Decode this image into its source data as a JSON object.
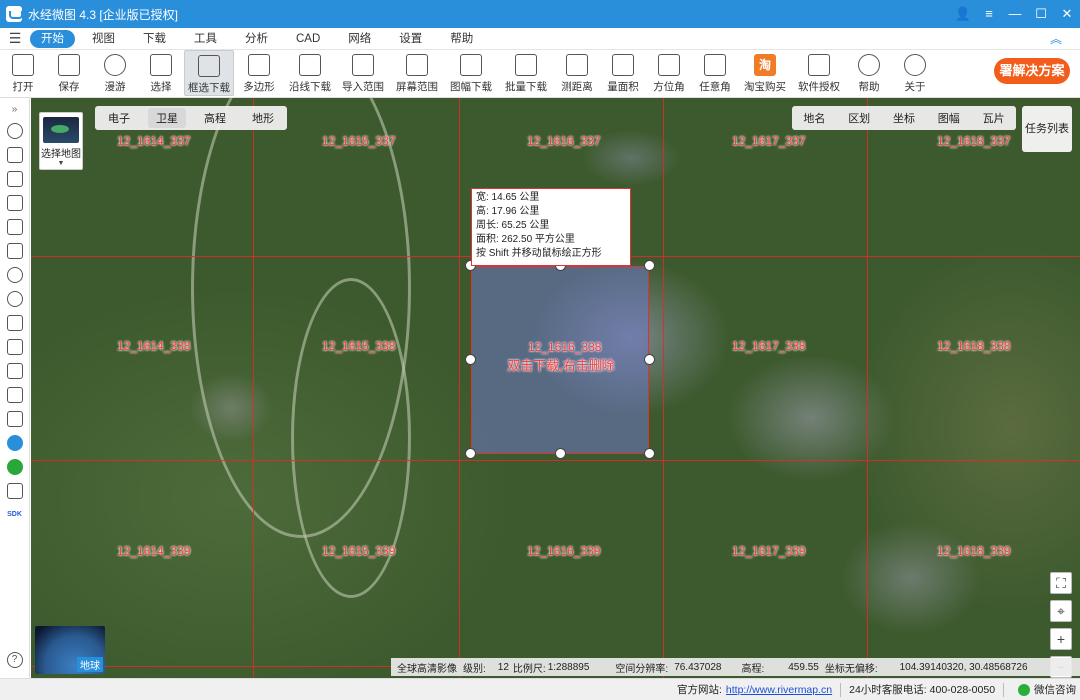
{
  "window": {
    "title": "水经微图 4.3 [企业版已授权]",
    "controls": [
      "👤",
      "≡",
      "—",
      "☐",
      "✕"
    ]
  },
  "menu": {
    "items": [
      "开始",
      "视图",
      "下载",
      "工具",
      "分析",
      "CAD",
      "网络",
      "设置",
      "帮助"
    ],
    "active": "开始"
  },
  "toolbar": {
    "items": [
      "打开",
      "保存",
      "漫游",
      "选择",
      "框选下载",
      "多边形",
      "沿线下载",
      "导入范围",
      "屏幕范围",
      "图幅下载",
      "批量下载",
      "测距离",
      "量面积",
      "方位角",
      "任意角",
      "淘宝购买",
      "软件授权",
      "帮助",
      "关于"
    ],
    "selected": "框选下载",
    "promo": "署解决方案",
    "taobao_glyph": "淘"
  },
  "map": {
    "basemap_label": "选择地图",
    "map_types": [
      "电子",
      "卫星",
      "高程",
      "地形"
    ],
    "map_type_active": "卫星",
    "layers": [
      "地名",
      "区划",
      "坐标",
      "图幅",
      "瓦片"
    ],
    "task_list": "任务列表",
    "globe_label": "地球",
    "tiles": [
      "12_1614_337",
      "12_1615_337",
      "12_1616_337",
      "12_1617_337",
      "12_1618_337",
      "12_1614_338",
      "12_1615_338",
      "12_1616_338",
      "12_1617_338",
      "12_1618_338",
      "12_1614_339",
      "12_1615_339",
      "12_1616_339",
      "12_1617_339",
      "12_1618_339"
    ],
    "selection_hint": "双击下载,右击删除",
    "info": {
      "width": "宽:  14.65 公里",
      "height": "高:  17.96 公里",
      "perimeter": "周长: 65.25 公里",
      "area": "面积: 262.50 平方公里",
      "tip": "按 Shift 并移动鼠标绘正方形"
    },
    "zoom": [
      "⌖",
      "+",
      "−"
    ],
    "fullscreen": "⛶"
  },
  "coord_bar": {
    "source": "全球高清影像",
    "level_label": "级别:",
    "level": "12",
    "scale_label": "比例尺:",
    "scale": "1:288895",
    "resolution_label": "空间分辨率:",
    "resolution": "76.437028",
    "elevation_label": "高程:",
    "elevation": "459.55",
    "offset_label": "坐标无偏移:",
    "coordinates": "104.39140320, 30.48568726"
  },
  "status": {
    "site_label": "官方网站:",
    "site_url": "http://www.rivermap.cn",
    "phone": "24小时客服电话: 400-028-0050",
    "wechat": "微信咨询"
  }
}
